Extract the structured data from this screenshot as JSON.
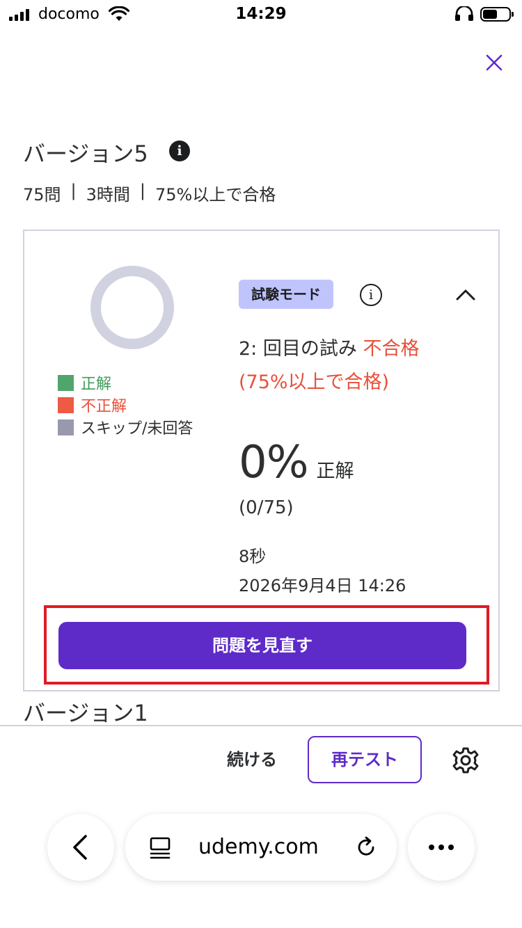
{
  "status_bar": {
    "carrier": "docomo",
    "time": "14:29"
  },
  "exam": {
    "title": "バージョン5",
    "info_icon_glyph": "i",
    "meta": {
      "questions": "75問",
      "duration": "3時間",
      "pass_condition": "75%以上で合格",
      "separator": "|"
    }
  },
  "result": {
    "mode_badge": "試験モード",
    "info_icon_glyph": "i",
    "attempt_prefix": "2: 回目の試み ",
    "attempt_status": "不合格 (75%以上で合格)",
    "score_percent": "0%",
    "score_label": "正解",
    "score_fraction": "(0/75)",
    "elapsed": "8秒",
    "datetime": "2026年9月4日 14:26",
    "review_button": "問題を見直す",
    "legend": [
      {
        "label": "正解",
        "color": "#4fa56b",
        "text_color": "#3f9b5c"
      },
      {
        "label": "不正解",
        "color": "#ee5a44",
        "text_color": "#e8503a"
      },
      {
        "label": "スキップ/未回答",
        "color": "#9899ad",
        "text_color": "#2d2f31"
      }
    ],
    "donut": {
      "correct": 0,
      "incorrect": 0,
      "skipped": 75,
      "color": "#d1d2e0"
    }
  },
  "next_exam_title": "バージョン1",
  "action_bar": {
    "continue_label": "続ける",
    "retest_label": "再テスト"
  },
  "browser": {
    "url": "udemy.com"
  },
  "colors": {
    "accent": "#5e2bc9",
    "fail": "#e8503a",
    "highlight_box": "#e01b24"
  }
}
